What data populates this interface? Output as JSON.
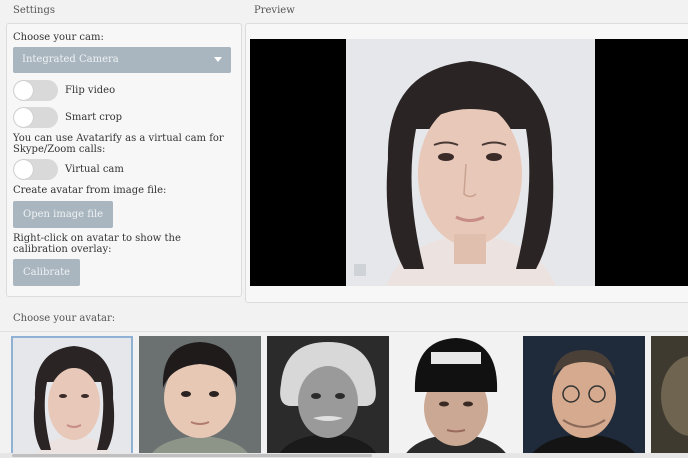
{
  "settings": {
    "title": "Settings",
    "choose_cam_label": "Choose your cam:",
    "cam_select_value": "Integrated Camera",
    "flip_video_label": "Flip video",
    "smart_crop_label": "Smart crop",
    "virtual_cam_info": [
      "You can use Avatarify as a virtual cam for",
      "Skype/Zoom calls:"
    ],
    "virtual_cam_label": "Virtual cam",
    "create_avatar_label": "Create avatar from image file:",
    "open_image_button": "Open image file",
    "calibration_info": [
      "Right-click on avatar to show the",
      "calibration overlay:"
    ],
    "calibrate_button": "Calibrate"
  },
  "preview": {
    "title": "Preview"
  },
  "avatars": {
    "title": "Choose your avatar:",
    "items": [
      {
        "name": "avatar-1",
        "selected": true
      },
      {
        "name": "avatar-2",
        "selected": false
      },
      {
        "name": "avatar-3",
        "selected": false
      },
      {
        "name": "avatar-4",
        "selected": false
      },
      {
        "name": "avatar-5",
        "selected": false
      },
      {
        "name": "avatar-6",
        "selected": false
      }
    ]
  },
  "colors": {
    "button": "#a9b6bf",
    "toggle_off": "#d9d9d9",
    "selection": "#8fb1d3"
  }
}
